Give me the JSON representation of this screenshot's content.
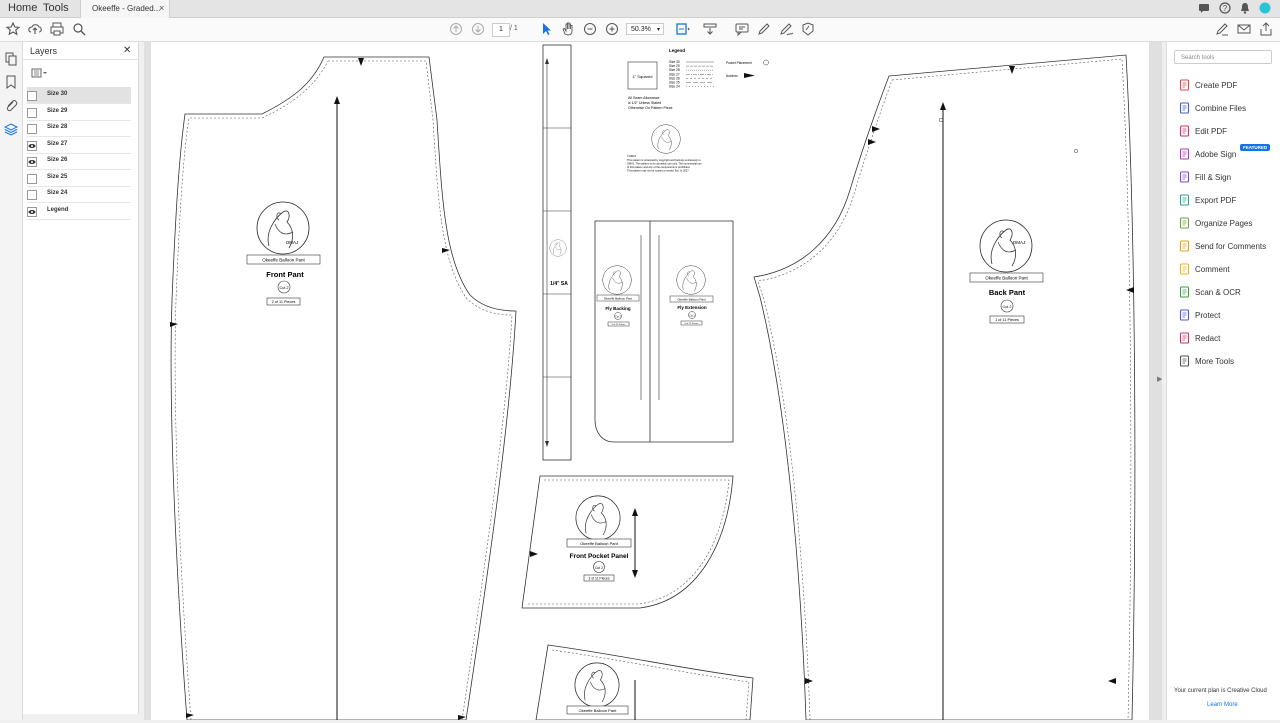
{
  "tabs": {
    "home": "Home",
    "tools": "Tools",
    "document": "Okeeffe - Graded...",
    "close": "×"
  },
  "toolbar": {
    "page_current": "1",
    "page_total": "/ 1",
    "zoom": "50.3%"
  },
  "layers_panel": {
    "title": "Layers",
    "close": "✕",
    "items": [
      {
        "label": "Size 30",
        "visible": false
      },
      {
        "label": "Size 29",
        "visible": false
      },
      {
        "label": "Size 28",
        "visible": false
      },
      {
        "label": "Size 27",
        "visible": true
      },
      {
        "label": "Size 26",
        "visible": true
      },
      {
        "label": "Size 25",
        "visible": false
      },
      {
        "label": "Size 24",
        "visible": false
      },
      {
        "label": "Legend",
        "visible": true
      }
    ]
  },
  "document": {
    "front_pant": {
      "name": "Front Pant",
      "brand": "OMAJ",
      "label": "Okeeffe Balloon Pant",
      "cut": "Cut 2",
      "pieces": "2 of 11 Pieces"
    },
    "back_pant": {
      "name": "Back Pant",
      "brand": "OMAJ",
      "label": "Okeeffe Balloon Pant",
      "cut": "Cut 2",
      "pieces": "1 of 11 Pieces"
    },
    "front_pocket_panel": {
      "name": "Front Pocket Panel",
      "brand": "OMAJ",
      "label": "Okeeffe Balloon Pant",
      "cut": "Cut 2",
      "pieces": "3 of 11 Pieces"
    },
    "fly_backing": {
      "name": "Fly Backing",
      "brand": "OMAJ",
      "label": "Okeeffe Balloon Pant",
      "cut": "Cut 1",
      "pieces": "5 of 11 Pieces"
    },
    "fly_extension": {
      "name": "Fly Extension",
      "brand": "OMAJ",
      "label": "Okeeffe Balloon Pant",
      "cut": "Cut 1",
      "pieces": "6 of 11 Pieces"
    },
    "waistband": {
      "brand": "OMAJ",
      "sa": "1/4\" SA"
    },
    "bottom_piece": {
      "brand": "OMAJ",
      "label": "Okeeffe Balloon Pant"
    },
    "legend": {
      "title": "Legend",
      "square": "1\" Squared",
      "sizes": [
        "Size 30",
        "Size 29",
        "Size 28",
        "Size 27",
        "Size 26",
        "Size 25",
        "Size 24"
      ],
      "pocket_placement": "Pocket Placement",
      "notches": "Notches",
      "seam_note": [
        "All Seam Allowance",
        "is 1/2\" Unless Stated",
        "Otherwise On Pattern Piece"
      ],
      "copyright": [
        "©OMAJ",
        "This pattern is protected by copyright and belongs exclusively to",
        "OMAJ. This pattern is for domestic use only. The commercial use",
        "of this pattern and any of the components is prohibited.",
        "This pattern may not be copied or resold. Est. In 2017."
      ]
    }
  },
  "tools_pane": {
    "search_placeholder": "Search tools",
    "featured_badge": "FEATURED",
    "items": [
      {
        "label": "Create PDF",
        "color": "#e34850"
      },
      {
        "label": "Combine Files",
        "color": "#4a5ec2"
      },
      {
        "label": "Edit PDF",
        "color": "#d0306e"
      },
      {
        "label": "Adobe Sign",
        "color": "#b03ab6"
      },
      {
        "label": "Fill & Sign",
        "color": "#7a4bd0"
      },
      {
        "label": "Export PDF",
        "color": "#2aa198"
      },
      {
        "label": "Organize Pages",
        "color": "#6aa53a"
      },
      {
        "label": "Send for Comments",
        "color": "#e0a515"
      },
      {
        "label": "Comment",
        "color": "#e8b416"
      },
      {
        "label": "Scan & OCR",
        "color": "#3ca03c"
      },
      {
        "label": "Protect",
        "color": "#5058c8"
      },
      {
        "label": "Redact",
        "color": "#d0306e"
      },
      {
        "label": "More Tools",
        "color": "#555555"
      }
    ],
    "plan_text": "Your current plan is Creative Cloud",
    "learn_more": "Learn More"
  },
  "colors": {
    "accent": "#1473e6",
    "avatar": "#2bc4d4"
  }
}
